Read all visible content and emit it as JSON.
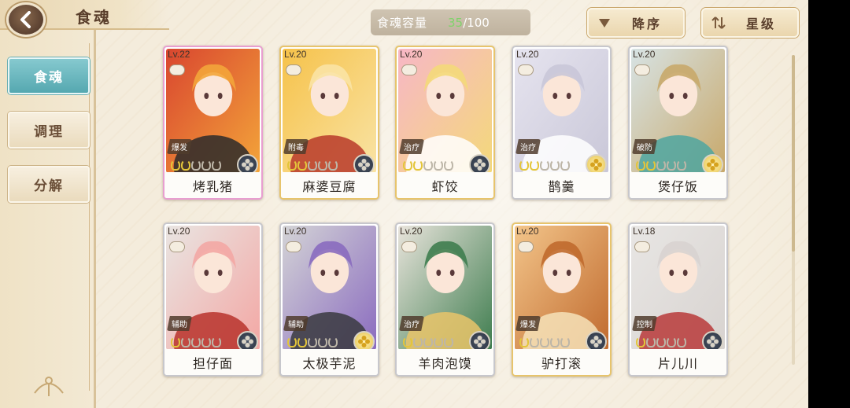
{
  "header": {
    "title": "食魂"
  },
  "sidebar": {
    "tabs": [
      {
        "label": "食魂",
        "active": true
      },
      {
        "label": "调理",
        "active": false
      },
      {
        "label": "分解",
        "active": false
      }
    ]
  },
  "capacity": {
    "label": "食魂容量",
    "current": "35",
    "max": "/100"
  },
  "sort_buttons": {
    "order_label": "降序",
    "star_label": "星级"
  },
  "colors": {
    "accent_teal": "#55a8b0",
    "capacity_green": "#7fd36a",
    "brown_text": "#5a3f2c"
  },
  "cards": [
    {
      "level": "Lv.22",
      "role": "爆发",
      "name": "烤乳猪",
      "frame": "rainbow",
      "stars_filled": 2,
      "emblem": "dark",
      "art": [
        "#d9462f",
        "#f3a53a",
        "#2c2a2a"
      ]
    },
    {
      "level": "Lv.20",
      "role": "附毒",
      "name": "麻婆豆腐",
      "frame": "gold",
      "stars_filled": 2,
      "emblem": "dark",
      "art": [
        "#f6c24a",
        "#f9e3a4",
        "#b93a2a"
      ]
    },
    {
      "level": "Lv.20",
      "role": "治疗",
      "name": "虾饺",
      "frame": "gold",
      "stars_filled": 2,
      "emblem": "dark",
      "art": [
        "#f7b7c6",
        "#f4d97a",
        "#ffffff"
      ]
    },
    {
      "level": "Lv.20",
      "role": "治疗",
      "name": "鹊羹",
      "frame": "silver",
      "stars_filled": 2,
      "emblem": "gold",
      "art": [
        "#e6e4ef",
        "#c9c7d8",
        "#ffffff"
      ]
    },
    {
      "level": "Lv.20",
      "role": "破防",
      "name": "煲仔饭",
      "frame": "silver",
      "stars_filled": 2,
      "emblem": "gold",
      "art": [
        "#d7e3e4",
        "#c8a86a",
        "#4fa6a0"
      ]
    },
    {
      "level": "Lv.20",
      "role": "辅助",
      "name": "担仔面",
      "frame": "silver",
      "stars_filled": 1,
      "emblem": "dark",
      "art": [
        "#e9e5e2",
        "#f3a7a4",
        "#b9332c"
      ]
    },
    {
      "level": "Lv.20",
      "role": "辅助",
      "name": "太极芋泥",
      "frame": "silver",
      "stars_filled": 2,
      "emblem": "gold",
      "art": [
        "#d4d4d6",
        "#8a6bbf",
        "#3a3a40"
      ]
    },
    {
      "level": "Lv.20",
      "role": "治疗",
      "name": "羊肉泡馍",
      "frame": "silver",
      "stars_filled": 1,
      "emblem": "dark",
      "art": [
        "#e9e4dc",
        "#3f7d4f",
        "#e9c46a"
      ]
    },
    {
      "level": "Lv.20",
      "role": "爆发",
      "name": "驴打滚",
      "frame": "gold",
      "stars_filled": 1,
      "emblem": "dark",
      "art": [
        "#f3c58a",
        "#c06a2e",
        "#f6e2b8"
      ]
    },
    {
      "level": "Lv.18",
      "role": "控制",
      "name": "片儿川",
      "frame": "silver",
      "stars_filled": 1,
      "emblem": "dark",
      "art": [
        "#e8e6e4",
        "#d8d3d0",
        "#b93a3a"
      ]
    }
  ]
}
